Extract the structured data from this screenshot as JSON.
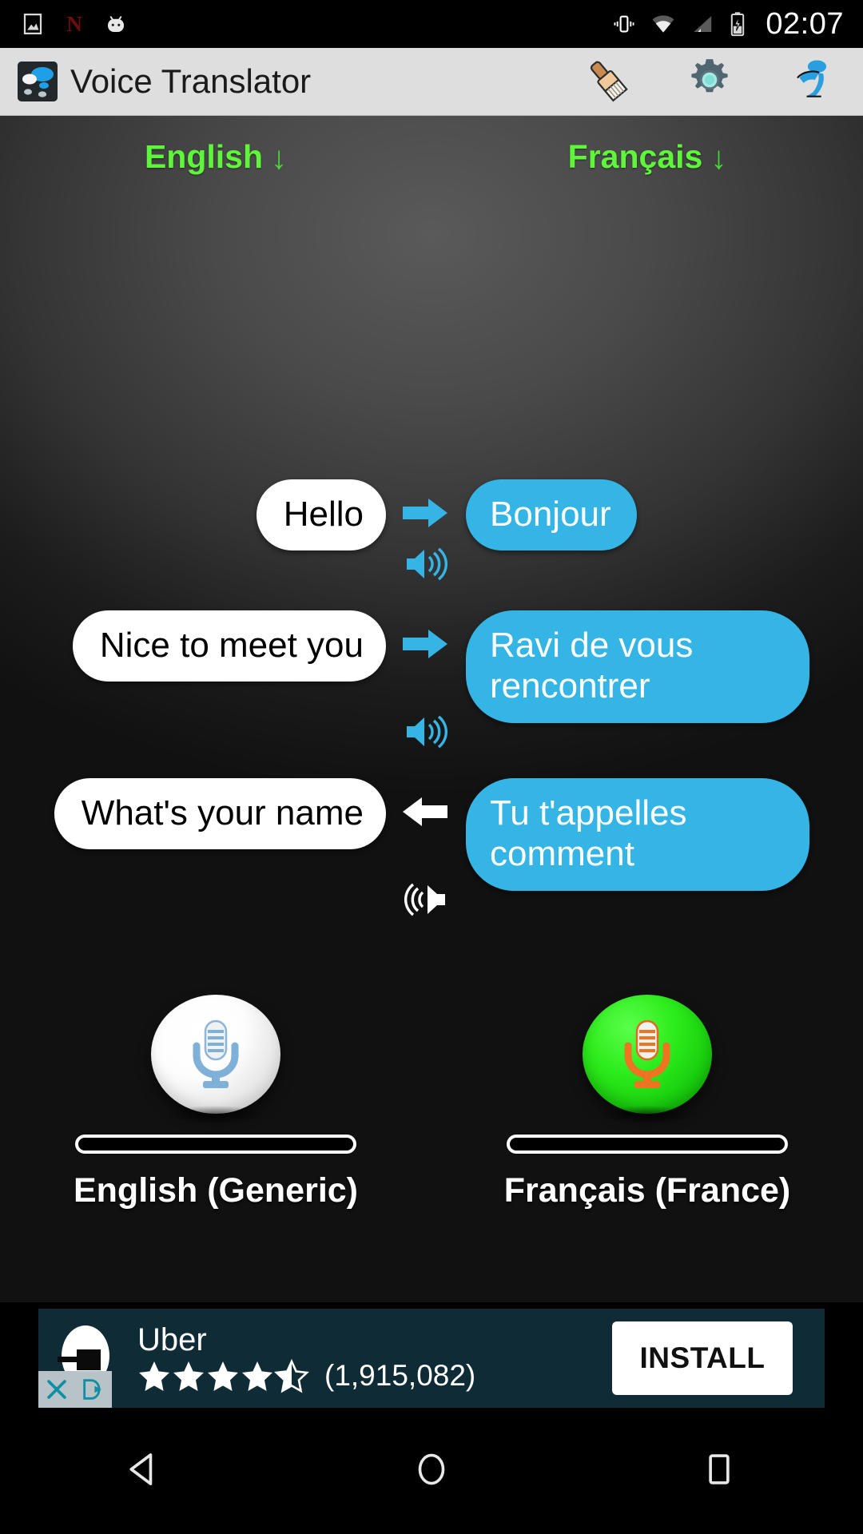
{
  "status_bar": {
    "time": "02:07",
    "left_icons": [
      "screenshot-icon",
      "netflix-n-icon",
      "android-head-icon"
    ],
    "right_icons": [
      "vibrate-icon",
      "wifi-icon",
      "cell-signal-icon",
      "battery-charging-icon"
    ]
  },
  "action_bar": {
    "app_icon": "speech-bubbles-icon",
    "title": "Voice Translator",
    "actions": [
      {
        "name": "clear-brush-icon",
        "label": "Clear"
      },
      {
        "name": "settings-gear-icon",
        "label": "Settings"
      },
      {
        "name": "info-icon",
        "label": "Info"
      }
    ]
  },
  "language_selectors": {
    "source": {
      "label": "English",
      "arrow": "↓"
    },
    "target": {
      "label": "Français",
      "arrow": "↓"
    }
  },
  "translations": [
    {
      "source": "Hello",
      "target": "Bonjour",
      "direction": "ltr",
      "arrow_icon": "arrow-right-icon",
      "speaker_icon": "speaker-right-icon"
    },
    {
      "source": "Nice to meet you",
      "target": "Ravi de vous rencontrer",
      "direction": "ltr",
      "arrow_icon": "arrow-right-icon",
      "speaker_icon": "speaker-right-icon"
    },
    {
      "source": "What's your name",
      "target": "Tu t'appelles comment",
      "direction": "rtl",
      "arrow_icon": "arrow-left-icon",
      "speaker_icon": "speaker-left-icon"
    }
  ],
  "mic_panel": {
    "left": {
      "mic_icon": "microphone-icon",
      "state": "idle",
      "caption": "English (Generic)"
    },
    "right": {
      "mic_icon": "microphone-icon",
      "state": "active",
      "caption": "Français (France)"
    }
  },
  "ad": {
    "app_name": "Uber",
    "rating": 4.5,
    "review_count": "(1,915,082)",
    "cta": "INSTALL",
    "close_badge": "×",
    "info_badge": "ad-choices-icon"
  },
  "nav_bar": {
    "back": "back-triangle-icon",
    "home": "home-circle-icon",
    "recents": "recents-square-icon"
  },
  "colors": {
    "accent_blue": "#35b5e5",
    "accent_green": "#5ef53a",
    "mic_active_green": "#2dec1c",
    "action_bar_bg": "#dedede",
    "ad_bg": "#0e2b36"
  }
}
